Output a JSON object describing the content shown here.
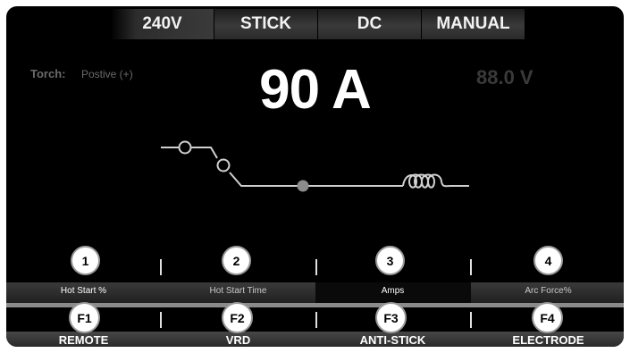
{
  "top_tabs": [
    "240V",
    "STICK",
    "DC",
    "MANUAL"
  ],
  "torch": {
    "label": "Torch:",
    "value": "Postive (+)"
  },
  "current_readout": "90 A",
  "voltage_readout": "88.0 V",
  "params": [
    {
      "number": "1",
      "label": "Hot Start %"
    },
    {
      "number": "2",
      "label": "Hot Start Time"
    },
    {
      "number": "3",
      "label": "Amps"
    },
    {
      "number": "4",
      "label": "Arc Force%"
    }
  ],
  "active_param": "3",
  "functions": [
    {
      "key": "F1",
      "label": "REMOTE"
    },
    {
      "key": "F2",
      "label": "VRD"
    },
    {
      "key": "F3",
      "label": "ANTI-STICK"
    },
    {
      "key": "F4",
      "label": "ELECTRODE"
    }
  ],
  "colors": {
    "background": "#000000",
    "text": "#ffffff",
    "dim_text": "#6a6a6a",
    "curve": "#d0d0d0",
    "active_node": "#8c8c8c"
  }
}
